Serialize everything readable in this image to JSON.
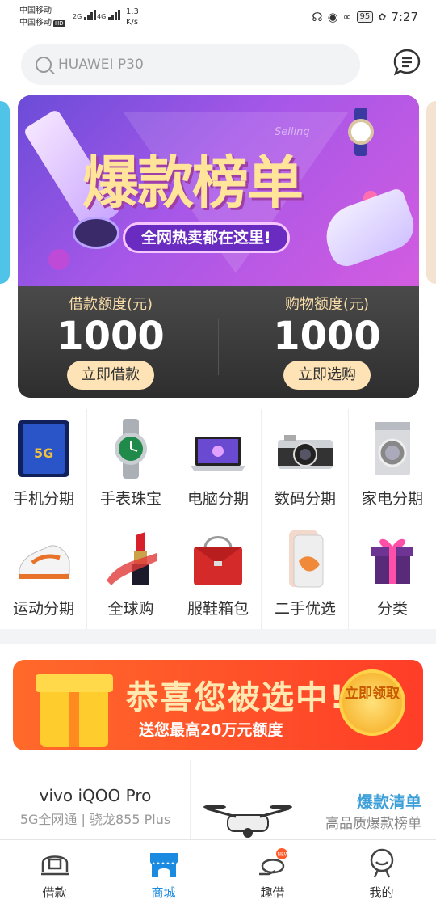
{
  "status_bar": {
    "carrier1": "中国移动",
    "carrier2": "中国移动",
    "hd": "HD",
    "net1": "2G",
    "net2": "4G",
    "speed_value": "1.3",
    "speed_unit": "K/s",
    "battery": "95",
    "time": "7:27"
  },
  "search": {
    "placeholder": "HUAWEI P30"
  },
  "banner": {
    "headline": "爆款榜单",
    "slogan": "全网热卖都在这里!",
    "watermark": "Selling",
    "left_label": "借款额度(元)",
    "left_value": "1000",
    "left_button": "立即借款",
    "right_label": "购物额度(元)",
    "right_value": "1000",
    "right_button": "立即选购"
  },
  "categories": [
    {
      "label": "手机分期",
      "icon": "phone-icon"
    },
    {
      "label": "手表珠宝",
      "icon": "watch-icon"
    },
    {
      "label": "电脑分期",
      "icon": "laptop-icon"
    },
    {
      "label": "数码分期",
      "icon": "camera-icon"
    },
    {
      "label": "家电分期",
      "icon": "washer-icon"
    },
    {
      "label": "运动分期",
      "icon": "sneaker-icon"
    },
    {
      "label": "全球购",
      "icon": "lipstick-icon"
    },
    {
      "label": "服鞋箱包",
      "icon": "handbag-icon"
    },
    {
      "label": "二手优选",
      "icon": "iphone-icon"
    },
    {
      "label": "分类",
      "icon": "gift-box-icon"
    }
  ],
  "promo": {
    "title": "恭喜您被选中!",
    "subtitle": "送您最高20万元额度",
    "coin": "立即领取"
  },
  "cards": {
    "left_title": "vivo iQOO Pro",
    "left_subtitle": "5G全网通 | 骁龙855 Plus",
    "right_title": "爆款清单",
    "right_subtitle": "高品质爆款榜单"
  },
  "tabbar": [
    {
      "label": "借款",
      "icon": "loan-icon"
    },
    {
      "label": "商城",
      "icon": "mall-icon"
    },
    {
      "label": "趣借",
      "icon": "fun-loan-icon"
    },
    {
      "label": "我的",
      "icon": "profile-icon"
    }
  ],
  "colors": {
    "accent": "#1a8be0",
    "gold": "#fde3b5",
    "promo_red": "#ff3d28"
  }
}
